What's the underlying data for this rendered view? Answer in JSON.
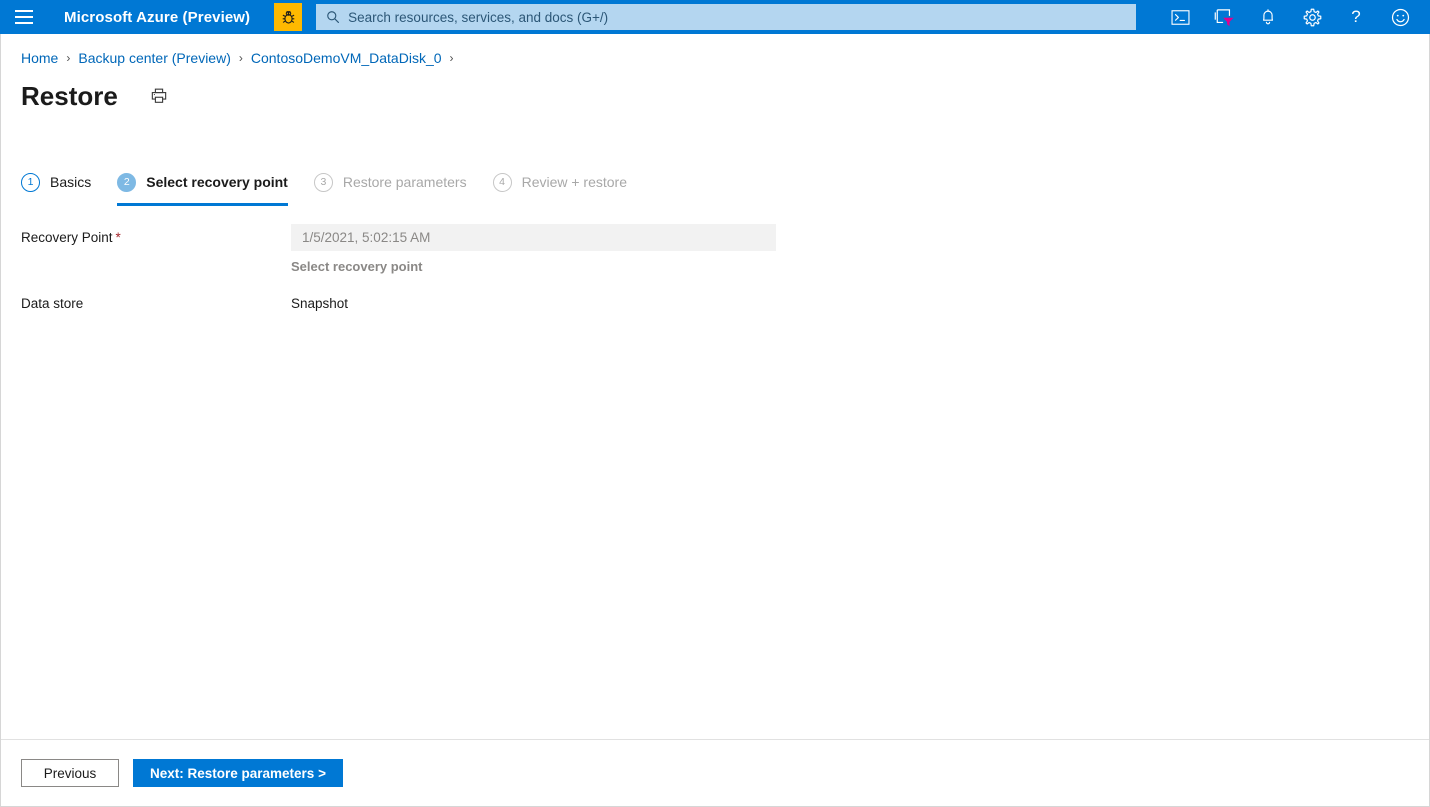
{
  "topbar": {
    "menu_icon": "hamburger-menu-icon",
    "brand": "Microsoft Azure (Preview)",
    "feedback_bug_icon": "bug-icon",
    "search": {
      "icon": "search-icon",
      "placeholder": "Search resources, services, and docs (G+/)",
      "value": ""
    },
    "actions": [
      {
        "name": "cloud-shell-icon",
        "glyph": "〉_"
      },
      {
        "name": "directory-filter-icon",
        "glyph": "filter"
      },
      {
        "name": "notifications-bell-icon",
        "glyph": "bell"
      },
      {
        "name": "settings-gear-icon",
        "glyph": "gear"
      },
      {
        "name": "help-question-icon",
        "glyph": "?"
      },
      {
        "name": "feedback-smiley-icon",
        "glyph": "smiley"
      }
    ],
    "colors": {
      "header_bg": "#0078d4",
      "search_bg": "#b4d6f0",
      "bug_bg": "#ffb900"
    }
  },
  "breadcrumb": {
    "separator": "›",
    "items": [
      {
        "label": "Home"
      },
      {
        "label": "Backup center (Preview)"
      },
      {
        "label": "ContosoDemoVM_DataDisk_0"
      }
    ]
  },
  "page": {
    "title": "Restore",
    "print_icon": "printer-icon"
  },
  "wizard": {
    "steps": [
      {
        "number": "1",
        "label": "Basics",
        "state": "done"
      },
      {
        "number": "2",
        "label": "Select recovery point",
        "state": "active"
      },
      {
        "number": "3",
        "label": "Restore parameters",
        "state": "disabled"
      },
      {
        "number": "4",
        "label": "Review + restore",
        "state": "disabled"
      }
    ],
    "active_underline_color": "#0078d4"
  },
  "form": {
    "recovery_point": {
      "label": "Recovery Point",
      "required_marker": "*",
      "value": "1/5/2021, 5:02:15 AM",
      "placeholder": "Select recovery point",
      "link_text": "Select recovery point"
    },
    "data_store": {
      "label": "Data store",
      "value": "Snapshot"
    }
  },
  "footer": {
    "previous_label": "Previous",
    "next_label": "Next: Restore parameters >"
  }
}
